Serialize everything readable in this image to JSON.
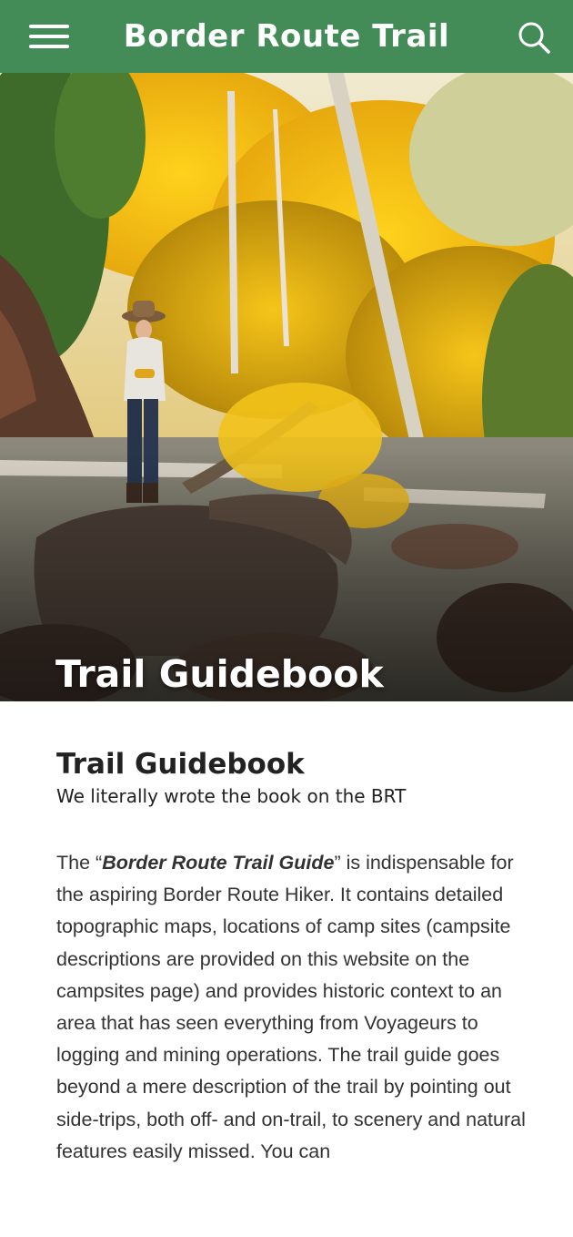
{
  "header": {
    "title": "Border Route Trail",
    "menu_icon": "hamburger-menu-icon",
    "search_icon": "search-icon",
    "bg_color": "#438b57"
  },
  "hero": {
    "title": "Trail Guidebook",
    "image": "woman-hiker-on-rocky-river-in-autumn-forest"
  },
  "main": {
    "heading": "Trail Guidebook",
    "subheading": "We literally wrote the book on the BRT",
    "intro_before": "The “",
    "book_title": "Border Route Trail Guide",
    "intro_after": "” is indispensable for the aspiring Border Route Hiker. It contains detailed topographic maps, locations of camp sites (campsite descriptions are provided on this website on the campsites page) and provides historic context to an area that has seen everything from Voyageurs to logging and mining operations. The trail guide goes beyond a mere description of the trail by pointing out side-trips, both off- and on-trail, to scenery and natural features easily missed. You can"
  }
}
